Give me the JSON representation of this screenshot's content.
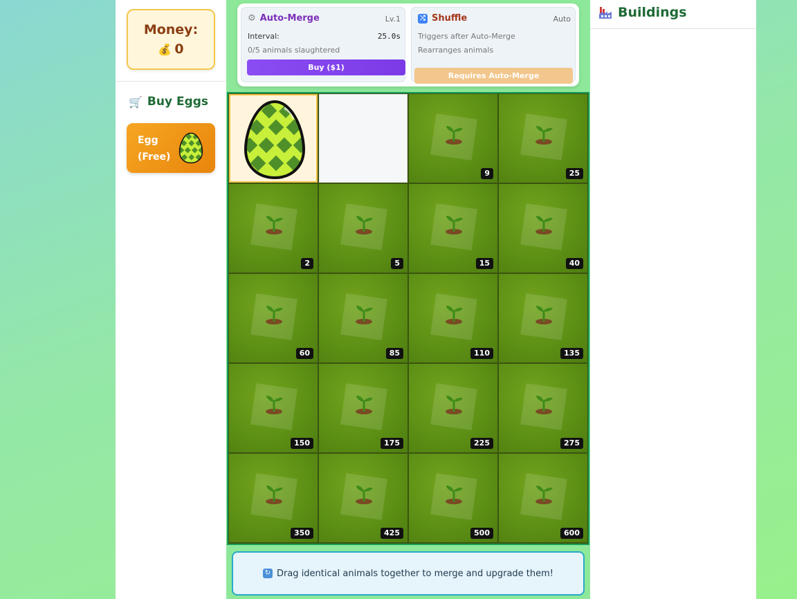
{
  "money": {
    "label": "Money:",
    "value": "0",
    "icon": "money-bag-icon"
  },
  "shop": {
    "title": "Buy Eggs",
    "egg_button": {
      "line1": "Egg",
      "line2": "(Free)"
    }
  },
  "auto_merge": {
    "title": "Auto-Merge",
    "level": "Lv.1",
    "interval_label": "Interval:",
    "interval_value": "25.0s",
    "progress": "0/5 animals slaughtered",
    "buy_label": "Buy ($1)"
  },
  "shuffle": {
    "title": "Shuffle",
    "mode": "Auto",
    "line1": "Triggers after Auto-Merge",
    "line2": "Rearranges animals",
    "button": "Requires Auto-Merge"
  },
  "grid": {
    "cells": [
      {
        "type": "egg",
        "value": ""
      },
      {
        "type": "empty",
        "value": ""
      },
      {
        "type": "grass",
        "value": "9"
      },
      {
        "type": "grass",
        "value": "25"
      },
      {
        "type": "grass",
        "value": "2"
      },
      {
        "type": "grass",
        "value": "5"
      },
      {
        "type": "grass",
        "value": "15"
      },
      {
        "type": "grass",
        "value": "40"
      },
      {
        "type": "grass",
        "value": "60"
      },
      {
        "type": "grass",
        "value": "85"
      },
      {
        "type": "grass",
        "value": "110"
      },
      {
        "type": "grass",
        "value": "135"
      },
      {
        "type": "grass",
        "value": "150"
      },
      {
        "type": "grass",
        "value": "175"
      },
      {
        "type": "grass",
        "value": "225"
      },
      {
        "type": "grass",
        "value": "275"
      },
      {
        "type": "grass",
        "value": "350"
      },
      {
        "type": "grass",
        "value": "425"
      },
      {
        "type": "grass",
        "value": "500"
      },
      {
        "type": "grass",
        "value": "600"
      }
    ]
  },
  "hint": "Drag identical animals together to merge and upgrade them!",
  "buildings": {
    "title": "Buildings"
  },
  "colors": {
    "accent_green": "#1f6a36",
    "money_text": "#8b3e12",
    "purple": "#7c3ae6",
    "orange": "#e8850c"
  }
}
